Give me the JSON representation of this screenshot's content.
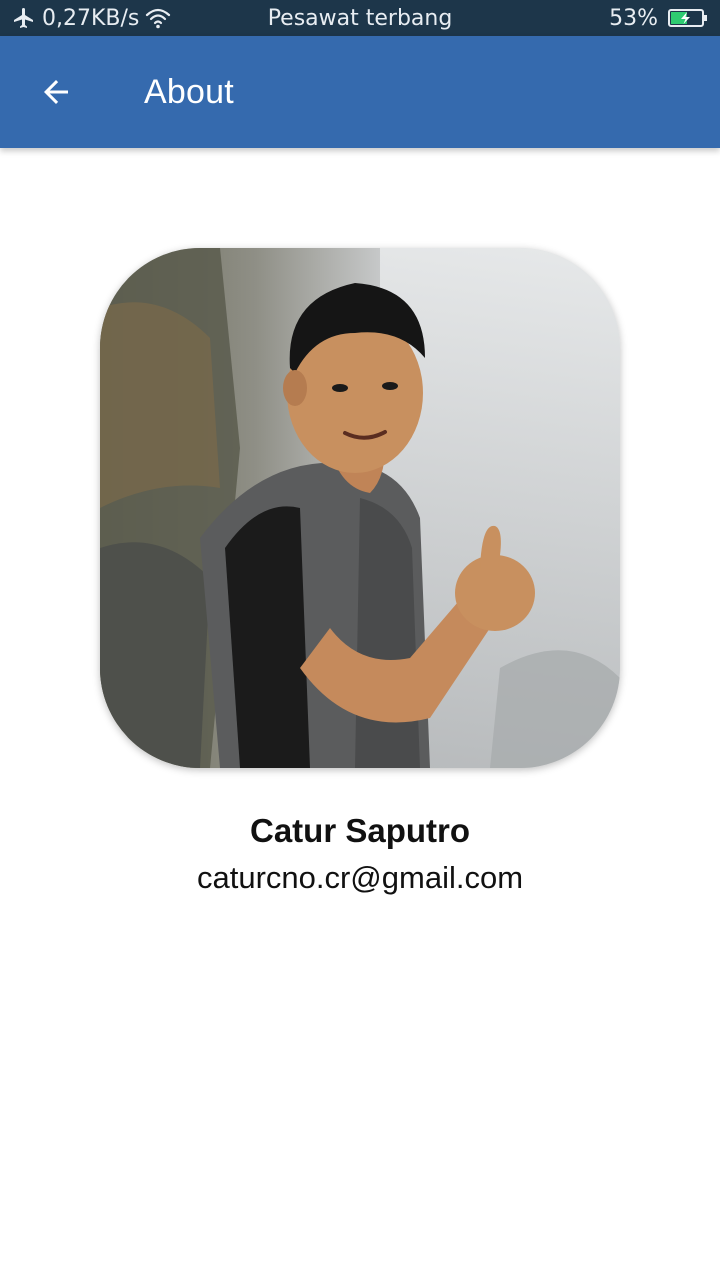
{
  "status_bar": {
    "speed": "0,27KB/s",
    "mode": "Pesawat terbang",
    "battery": "53%",
    "battery_level": 0.53,
    "icons": [
      "airplane-icon",
      "wifi-icon",
      "battery-charging-icon"
    ]
  },
  "app_bar": {
    "title": "About",
    "back_icon": "arrow-left-icon",
    "color": "#356aae"
  },
  "profile": {
    "name": "Catur Saputro",
    "email": "caturcno.cr@gmail.com"
  },
  "colors": {
    "status_bar": "#1d364a",
    "app_bar": "#356aae",
    "background": "#ffffff",
    "battery_fill": "#2ecc71"
  }
}
